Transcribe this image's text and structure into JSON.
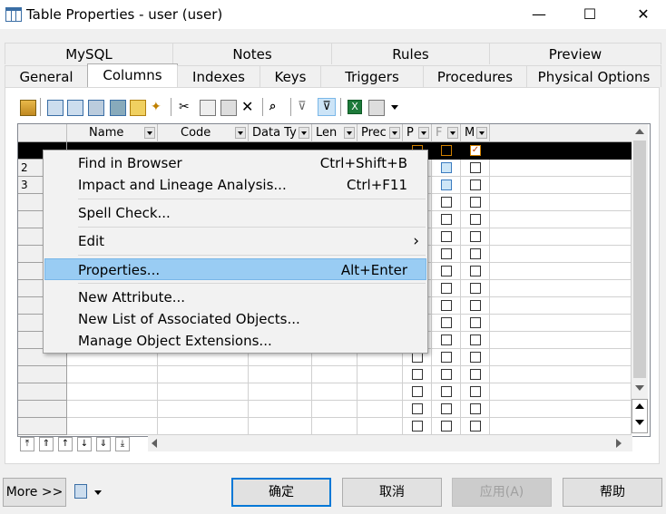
{
  "window": {
    "title": "Table Properties - user (user)",
    "minimize": "—",
    "maximize": "☐",
    "close": "✕"
  },
  "tabs_back": [
    "MySQL",
    "Notes",
    "Rules",
    "Preview"
  ],
  "tabs_front": [
    "General",
    "Columns",
    "Indexes",
    "Keys",
    "Triggers",
    "Procedures",
    "Physical Options"
  ],
  "active_tab": "Columns",
  "grid": {
    "columns": [
      "Name",
      "Code",
      "Data Ty",
      "Len",
      "Prec",
      "P",
      "F",
      "M"
    ],
    "row_numbers": [
      "",
      "2",
      "3"
    ]
  },
  "context_menu": {
    "items": [
      {
        "label": "Find in Browser",
        "shortcut": "Ctrl+Shift+B"
      },
      {
        "label": "Impact and Lineage Analysis...",
        "shortcut": "Ctrl+F11"
      },
      {
        "label": "Spell Check...",
        "shortcut": ""
      },
      {
        "label": "Edit",
        "shortcut": "›"
      },
      {
        "label": "Properties...",
        "shortcut": "Alt+Enter"
      },
      {
        "label": "New Attribute...",
        "shortcut": ""
      },
      {
        "label": "New List of Associated Objects...",
        "shortcut": ""
      },
      {
        "label": "Manage Object Extensions...",
        "shortcut": ""
      }
    ]
  },
  "buttons": {
    "more": "More >>",
    "ok": "确定",
    "cancel": "取消",
    "apply": "应用(A)",
    "help": "帮助"
  },
  "colors": {
    "accent": "#0078d7",
    "menu_highlight": "#99ccf3"
  }
}
